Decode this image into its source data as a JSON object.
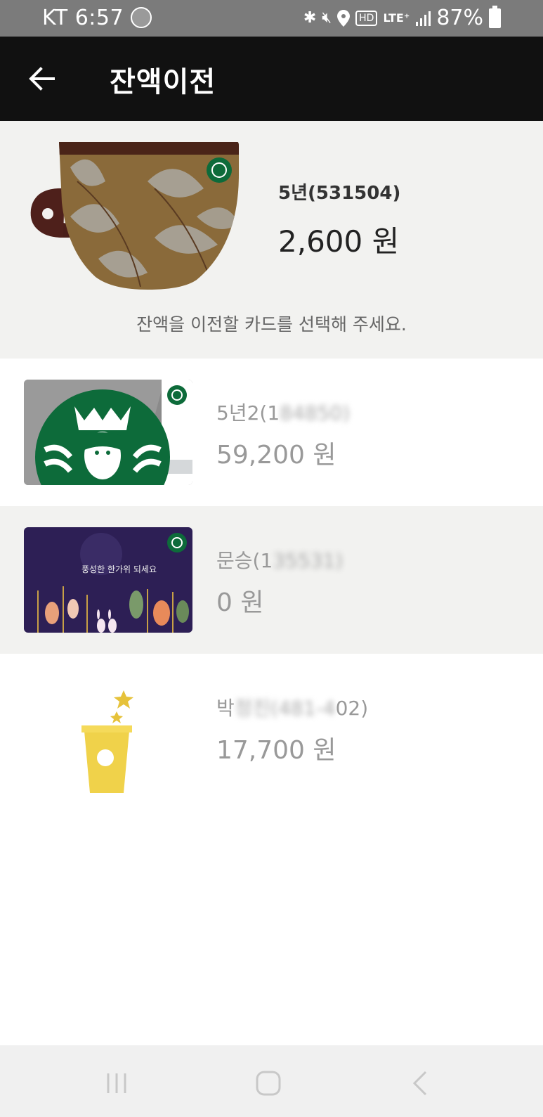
{
  "status_bar": {
    "carrier_time": "KT 6:57",
    "hd": "HD",
    "lte": "LTE⁺",
    "battery_pct": "87%"
  },
  "header": {
    "title": "잔액이전"
  },
  "selected_card": {
    "name": "5년(531504)",
    "balance": "2,600 원"
  },
  "instruction": "잔액을 이전할 카드를 선택해 주세요.",
  "cards": [
    {
      "name_visible": "5년2(1",
      "name_blurred": "84850)",
      "balance": "59,200 원"
    },
    {
      "name_visible": "문승(1",
      "name_blurred": "35531)",
      "balance": "0 원"
    },
    {
      "name_visible": "박",
      "name_blurred": "정진(481-4",
      "name_tail": "02)",
      "balance": "17,700 원"
    }
  ],
  "card2_art_text": "풍성한 한가위 되세요",
  "colors": {
    "status_bar": "#7b7b7b",
    "app_bar": "#111111",
    "selected_bg": "#f2f2f0",
    "starbucks_green": "#0d6b3a",
    "mug_brown": "#8a6a3a"
  }
}
